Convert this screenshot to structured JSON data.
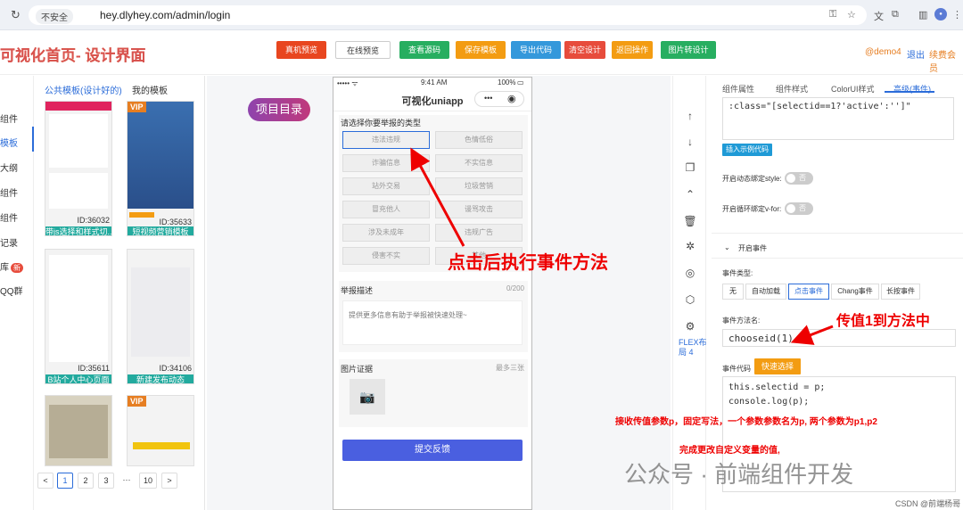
{
  "browser": {
    "security": "不安全",
    "url": "hey.dlyhey.com/admin/login"
  },
  "header": {
    "title": "可视化首页- 设计界面",
    "buttons": [
      {
        "label": "真机预览",
        "color": "#e8461f"
      },
      {
        "label": "在线预览",
        "color": "#ffffff"
      },
      {
        "label": "查看源码",
        "color": "#27ae60"
      },
      {
        "label": "保存模板",
        "color": "#f39c12"
      },
      {
        "label": "导出代码",
        "color": "#3498db"
      },
      {
        "label": "清空设计",
        "color": "#e74c3c"
      },
      {
        "label": "返回操作",
        "color": "#f39c12"
      },
      {
        "label": "图片转设计",
        "color": "#27ae60"
      }
    ],
    "user": "@demo4",
    "logout": "退出",
    "renew": "续费会员"
  },
  "left_nav": {
    "items": [
      "组件",
      "模板",
      "大纲",
      "组件",
      "组件",
      "记录",
      "库",
      "QQ群"
    ],
    "badge": "新"
  },
  "templates": {
    "tabs": [
      "公共模板(设计好的)",
      "我的模板"
    ],
    "vip": "VIP",
    "cards": [
      {
        "id": "ID:36032",
        "name": "带js选择和样式切..."
      },
      {
        "id": "ID:35633",
        "name": "短视频营销模板"
      },
      {
        "id": "ID:35611",
        "name": "B站个人中心页面"
      },
      {
        "id": "ID:34106",
        "name": "新建发布动态"
      }
    ],
    "pagination": [
      "<",
      "1",
      "2",
      "3",
      "···",
      "10",
      ">"
    ]
  },
  "canvas": {
    "project_button": "项目目录",
    "phone": {
      "status_time": "9:41 AM",
      "status_battery": "100%",
      "title": "可视化uniapp",
      "report_label": "请选择你要举报的类型",
      "options": [
        "违法违规",
        "色情低俗",
        "诈骗信息",
        "不实信息",
        "站外交易",
        "垃圾营销",
        "冒充他人",
        "谩骂攻击",
        "涉及未成年",
        "违规广告",
        "侵害不实",
        "其他"
      ],
      "desc_label": "举报描述",
      "desc_count": "0/200",
      "desc_placeholder": "提供更多信息有助于举报被快速处理~",
      "img_label": "图片证据",
      "img_count": "最多三张",
      "submit": "提交反馈"
    }
  },
  "annotations": {
    "click": "点击后执行事件方法",
    "pass": "传值1到方法中",
    "recv": "接收传值参数p，固定写法，一个参数参数名为p, 两个参数为p1,p2",
    "done": "完成更改自定义变量的值,",
    "watermark": "公众号 · 前端组件开发",
    "csdn": "CSDN @前端杨哥"
  },
  "right_tools": {
    "flex_label": "FLEX布局 4"
  },
  "props": {
    "tabs": [
      "组件属性",
      "组件样式",
      "ColorUI样式",
      "高级(事件)"
    ],
    "class_code": ":class=\"[selectid==1?'active':'']\"",
    "insert_example": "插入示例代码",
    "dynamic_style_label": "开启动态绑定style:",
    "loop_label": "开启循环绑定v-for:",
    "toggle_off": "否",
    "event_section": "开启事件",
    "event_type_label": "事件类型:",
    "event_types": [
      "无",
      "自动加载",
      "点击事件",
      "Chang事件",
      "长按事件"
    ],
    "method_label": "事件方法名:",
    "method_value": "chooseid(1)",
    "code_label": "事件代码",
    "quick_select": "快速选择",
    "code_lines": [
      "this.selectid = p;",
      "console.log(p);"
    ]
  }
}
